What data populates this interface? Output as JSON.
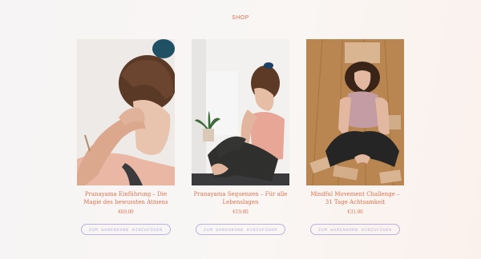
{
  "section": {
    "title": "SHOP"
  },
  "products": [
    {
      "title": "Pranayama Einführung – Die Magie des bewussten Atmens",
      "price": "€69.00",
      "button": "ZUM WARENKORB HINZUFÜGEN",
      "image_alt": "Frau mit geschlossenen Augen, Hand an der Stirn"
    },
    {
      "title": "Pranayama Sequenzen – Für alle Lebenslagen",
      "price": "€19.00",
      "button": "ZUM WARENKORB HINZUFÜGEN",
      "image_alt": "Frau sitzt auf einer Yogamatte"
    },
    {
      "title": "Mindful Movement Challenge – 31 Tage Achtsamkeit",
      "price": "€31.00",
      "button": "ZUM WARENKORB HINZUFÜGEN",
      "image_alt": "Frau sitzt im Schneidersitz mit Yogablock auf dem Kopf"
    }
  ],
  "colors": {
    "accent": "#e0704c",
    "button_border": "#b9b3dd"
  }
}
